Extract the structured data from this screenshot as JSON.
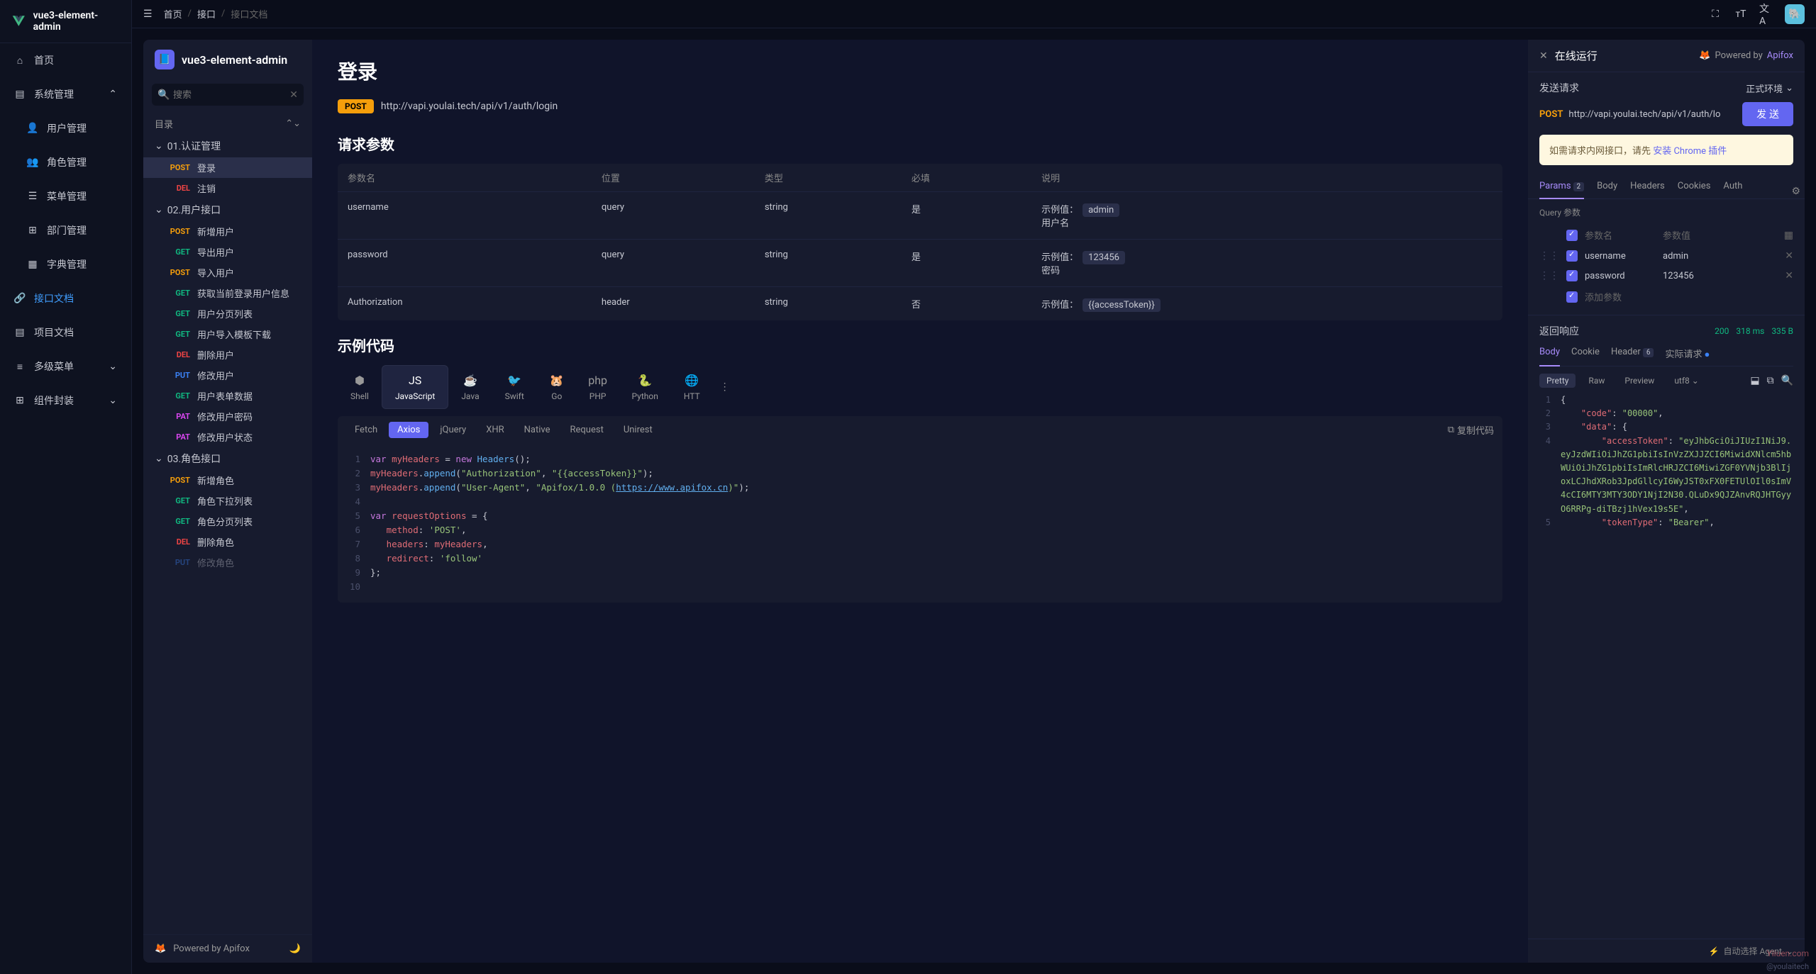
{
  "app": {
    "title": "vue3-element-admin"
  },
  "sidebar": {
    "items": {
      "home": "首页",
      "system": "系统管理",
      "userManage": "用户管理",
      "roleManage": "角色管理",
      "menuManage": "菜单管理",
      "deptManage": "部门管理",
      "dictManage": "字典管理",
      "apiDoc": "接口文档",
      "projDoc": "项目文档",
      "multiMenu": "多级菜单",
      "compPkg": "组件封装"
    }
  },
  "breadcrumb": {
    "home": "首页",
    "api": "接口",
    "current": "接口文档"
  },
  "doc": {
    "title": "vue3-element-admin",
    "searchPlaceholder": "搜索",
    "tocHeading": "目录",
    "groups": {
      "auth": "01.认证管理",
      "user": "02.用户接口",
      "role": "03.角色接口"
    },
    "items": {
      "login": "登录",
      "logout": "注销",
      "addUser": "新增用户",
      "exportUser": "导出用户",
      "importUser": "导入用户",
      "currentUser": "获取当前登录用户信息",
      "userPage": "用户分页列表",
      "importTpl": "用户导入模板下载",
      "delUser": "删除用户",
      "editUser": "修改用户",
      "userForm": "用户表单数据",
      "editPwd": "修改用户密码",
      "editStatus": "修改用户状态",
      "addRole": "新增角色",
      "roleDrop": "角色下拉列表",
      "rolePage": "角色分页列表",
      "delRole": "删除角色",
      "editRole": "修改角色"
    },
    "footer": "Powered by Apifox"
  },
  "page": {
    "title": "登录",
    "method": "POST",
    "url": "http://vapi.youlai.tech/api/v1/auth/login",
    "sections": {
      "params": "请求参数",
      "code": "示例代码"
    },
    "paramHeaders": {
      "name": "参数名",
      "location": "位置",
      "type": "类型",
      "required": "必填",
      "desc": "说明"
    },
    "params": [
      {
        "name": "username",
        "location": "query",
        "type": "string",
        "required": "是",
        "exLabel": "示例值：",
        "example": "admin",
        "desc": "用户名"
      },
      {
        "name": "password",
        "location": "query",
        "type": "string",
        "required": "是",
        "exLabel": "示例值：",
        "example": "123456",
        "desc": "密码"
      },
      {
        "name": "Authorization",
        "location": "header",
        "type": "string",
        "required": "否",
        "exLabel": "示例值：",
        "example": "{{accessToken}}",
        "desc": ""
      }
    ],
    "langs": [
      "Shell",
      "JavaScript",
      "Java",
      "Swift",
      "Go",
      "PHP",
      "Python",
      "HTT"
    ],
    "subTabs": [
      "Fetch",
      "Axios",
      "jQuery",
      "XHR",
      "Native",
      "Request",
      "Unirest"
    ],
    "copyLabel": "复制代码",
    "codeLines": [
      {
        "n": 1,
        "html": "<span class='k-kw'>var</span> <span class='k-var'>myHeaders</span> = <span class='k-new'>new</span> <span class='k-fn'>Headers</span>();"
      },
      {
        "n": 2,
        "html": "<span class='k-var'>myHeaders</span>.<span class='k-fn'>append</span>(<span class='k-str'>\"Authorization\"</span>, <span class='k-str'>\"{{accessToken}}\"</span>);"
      },
      {
        "n": 3,
        "html": "<span class='k-var'>myHeaders</span>.<span class='k-fn'>append</span>(<span class='k-str'>\"User-Agent\"</span>, <span class='k-str'>\"Apifox/1.0.0 (<span class='k-link'>https://www.apifox.cn</span>)\"</span>);"
      },
      {
        "n": 4,
        "html": ""
      },
      {
        "n": 5,
        "html": "<span class='k-kw'>var</span> <span class='k-var'>requestOptions</span> = {"
      },
      {
        "n": 6,
        "html": "&nbsp;&nbsp;&nbsp;<span class='k-var'>method</span>: <span class='k-str'>'POST'</span>,"
      },
      {
        "n": 7,
        "html": "&nbsp;&nbsp;&nbsp;<span class='k-var'>headers</span>: <span class='k-var'>myHeaders</span>,"
      },
      {
        "n": 8,
        "html": "&nbsp;&nbsp;&nbsp;<span class='k-var'>redirect</span>: <span class='k-str'>'follow'</span>"
      },
      {
        "n": 9,
        "html": "};"
      },
      {
        "n": 10,
        "html": ""
      }
    ]
  },
  "run": {
    "title": "在线运行",
    "powered": "Powered by",
    "poweredBrand": "Apifox",
    "sendLabel": "发送请求",
    "envLabel": "正式环境",
    "method": "POST",
    "url": "http://vapi.youlai.tech/api/v1/auth/lo",
    "sendBtn": "发 送",
    "noticePrefix": "如需请求内网接口，请先 ",
    "noticeLink": "安装 Chrome 插件",
    "tabs": {
      "params": "Params",
      "paramsCount": "2",
      "body": "Body",
      "headers": "Headers",
      "cookies": "Cookies",
      "auth": "Auth"
    },
    "query": {
      "heading": "Query 参数",
      "nameCol": "参数名",
      "valueCol": "参数值",
      "rows": [
        {
          "name": "username",
          "value": "admin"
        },
        {
          "name": "password",
          "value": "123456"
        }
      ],
      "addLabel": "添加参数"
    },
    "response": {
      "title": "返回响应",
      "code": "200",
      "time": "318 ms",
      "size": "335 B",
      "tabs": {
        "body": "Body",
        "cookie": "Cookie",
        "header": "Header",
        "headerCount": "6",
        "actual": "实际请求"
      },
      "tools": {
        "pretty": "Pretty",
        "raw": "Raw",
        "preview": "Preview",
        "encoding": "utf8"
      },
      "jsonLines": [
        {
          "n": 1,
          "html": "<span class='j-pun'>{</span>"
        },
        {
          "n": 2,
          "html": "&nbsp;&nbsp;&nbsp;&nbsp;<span class='j-key'>\"code\"</span><span class='j-pun'>: </span><span class='j-str'>\"00000\"</span><span class='j-pun'>,</span>"
        },
        {
          "n": 3,
          "html": "&nbsp;&nbsp;&nbsp;&nbsp;<span class='j-key'>\"data\"</span><span class='j-pun'>: {</span>"
        },
        {
          "n": 4,
          "html": "&nbsp;&nbsp;&nbsp;&nbsp;&nbsp;&nbsp;&nbsp;&nbsp;<span class='j-key'>\"accessToken\"</span><span class='j-pun'>: </span><span class='j-str'>\"eyJhbGciOiJIUzI1NiJ9.eyJzdWIiOiJhZG1pbiIsInVzZXJJZCI6MiwidXNlcm5hbWUiOiJhZG1pbiIsImRlcHRJZCI6MiwiZGF0YVNjb3BlIjoxLCJhdXRob3JpdGllcyI6WyJST0xFX0FETUlOIl0sImV4cCI6MTY3MTY3ODY1NjI2N30.QLuDx9QJZAnvRQJHTGyyO6RRPg-diTBzj1hVex19s5E\"</span><span class='j-pun'>,</span>"
        },
        {
          "n": 5,
          "html": "&nbsp;&nbsp;&nbsp;&nbsp;&nbsp;&nbsp;&nbsp;&nbsp;<span class='j-key'>\"tokenType\"</span><span class='j-pun'>: </span><span class='j-str'>\"Bearer\"</span><span class='j-pun'>,</span>"
        }
      ]
    },
    "agent": "自动选择 Agent"
  },
  "watermark": "Yiiuen.com",
  "handle": "@youlaitech"
}
